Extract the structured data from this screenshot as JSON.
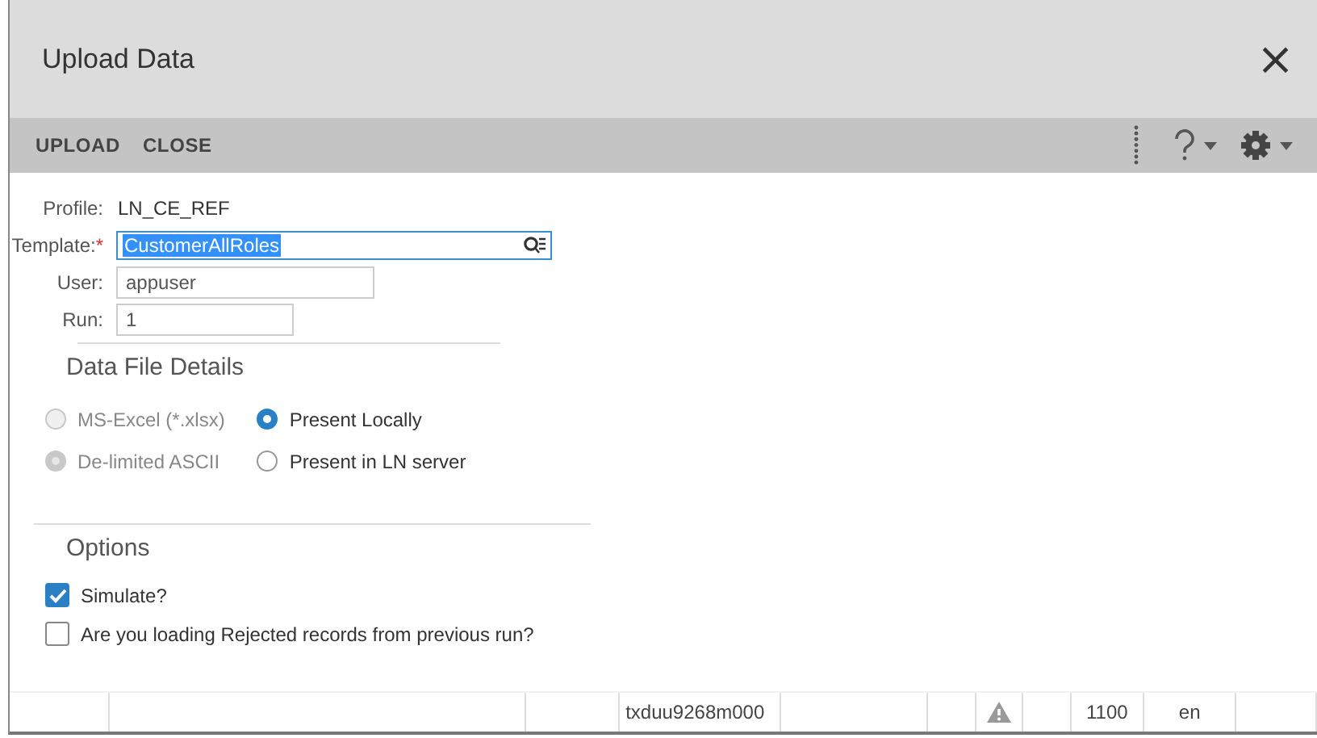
{
  "window": {
    "title": "Upload Data",
    "close": "×"
  },
  "toolbar": {
    "buttons": [
      "UPLOAD",
      "CLOSE"
    ]
  },
  "form": [
    {
      "kind": "text",
      "label": "Profile:",
      "value": "LN_CE_REF"
    },
    {
      "kind": "lookup",
      "label": "Template:",
      "required_mark": "*",
      "value": "CustomerAllRoles"
    },
    {
      "kind": "input",
      "label": "User:",
      "value": "appuser"
    },
    {
      "kind": "short",
      "label": "Run:",
      "value": "1"
    }
  ],
  "data_file": {
    "heading": "Data File Details",
    "format": [
      {
        "label": "MS-Excel (*.xlsx)",
        "selected": false,
        "disabled": true
      },
      {
        "label": "De-limited ASCII",
        "selected": true,
        "disabled": true
      }
    ],
    "location": [
      {
        "label": "Present Locally",
        "selected": true,
        "disabled": false
      },
      {
        "label": "Present in LN server",
        "selected": false,
        "disabled": false
      }
    ]
  },
  "options": {
    "heading": "Options",
    "items": [
      {
        "label": "Simulate?",
        "checked": true
      },
      {
        "label": "Are you loading Rejected records from previous run?",
        "checked": false
      }
    ]
  },
  "status_bar": [
    {
      "kind": "blank"
    },
    {
      "kind": "blank"
    },
    {
      "kind": "blank"
    },
    {
      "kind": "text",
      "text": "txduu9268m000"
    },
    {
      "kind": "blank"
    },
    {
      "kind": "blank"
    },
    {
      "kind": "warning"
    },
    {
      "kind": "blank"
    },
    {
      "kind": "text",
      "text": "1100"
    },
    {
      "kind": "text",
      "text": "en"
    },
    {
      "kind": "blank"
    }
  ]
}
